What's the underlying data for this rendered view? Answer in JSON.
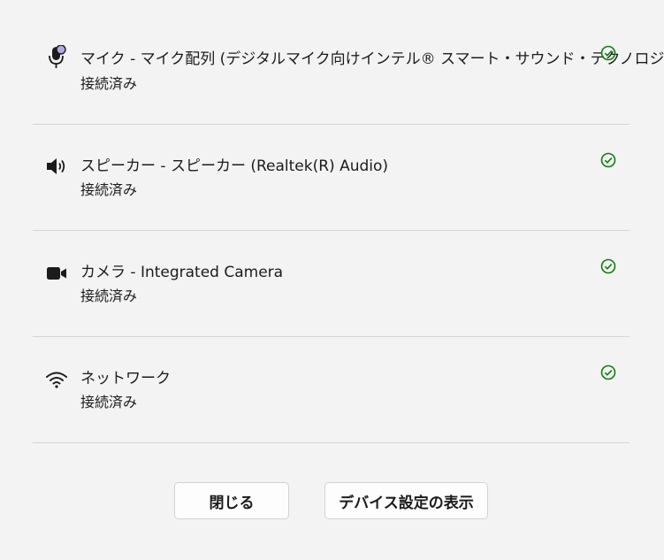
{
  "devices": [
    {
      "icon": "microphone-icon",
      "name": "マイク - マイク配列 (デジタルマイク向けインテル® スマート・サウンド・テクノロジー)",
      "status": "接続済み"
    },
    {
      "icon": "speaker-icon",
      "name": "スピーカー - スピーカー (Realtek(R) Audio)",
      "status": "接続済み"
    },
    {
      "icon": "camera-icon",
      "name": "カメラ - Integrated Camera",
      "status": "接続済み"
    },
    {
      "icon": "wifi-icon",
      "name": "ネットワーク",
      "status": "接続済み"
    }
  ],
  "buttons": {
    "close_label": "閉じる",
    "settings_label": "デバイス設定の表示"
  },
  "colors": {
    "check": "#107c10",
    "mic_accent": "#b4a7e6",
    "background": "#f3f3f3"
  }
}
